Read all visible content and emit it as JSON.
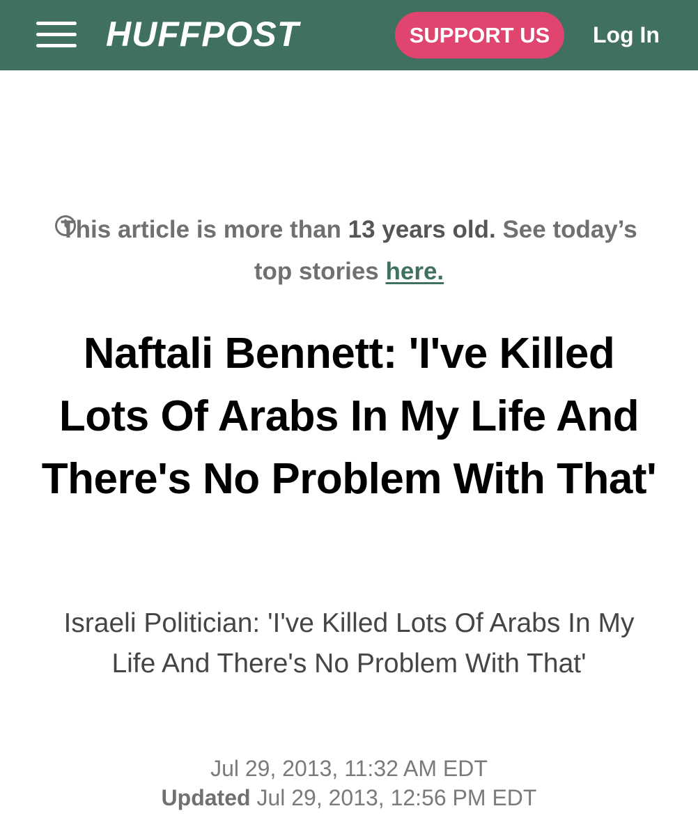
{
  "header": {
    "logo_text": "HUFFPOST",
    "support_label": "SUPPORT US",
    "login_label": "Log In",
    "brand_color": "#407060",
    "accent_color": "#e0456f"
  },
  "notice": {
    "icon": "clock-icon",
    "prefix": "This article is more than ",
    "age": "13 years old.",
    "middle": " See today’s top stories ",
    "link_label": "here."
  },
  "article": {
    "headline": "Naftali Bennett: 'I've Killed Lots Of Arabs In My Life And There's No Problem With That'",
    "subheadline": "Israeli Politician: 'I've Killed Lots Of Arabs In My Life And There's No Problem With That'",
    "published": "Jul 29, 2013, 11:32 AM EDT",
    "updated_label": "Updated",
    "updated": "Jul 29, 2013, 12:56 PM EDT"
  }
}
